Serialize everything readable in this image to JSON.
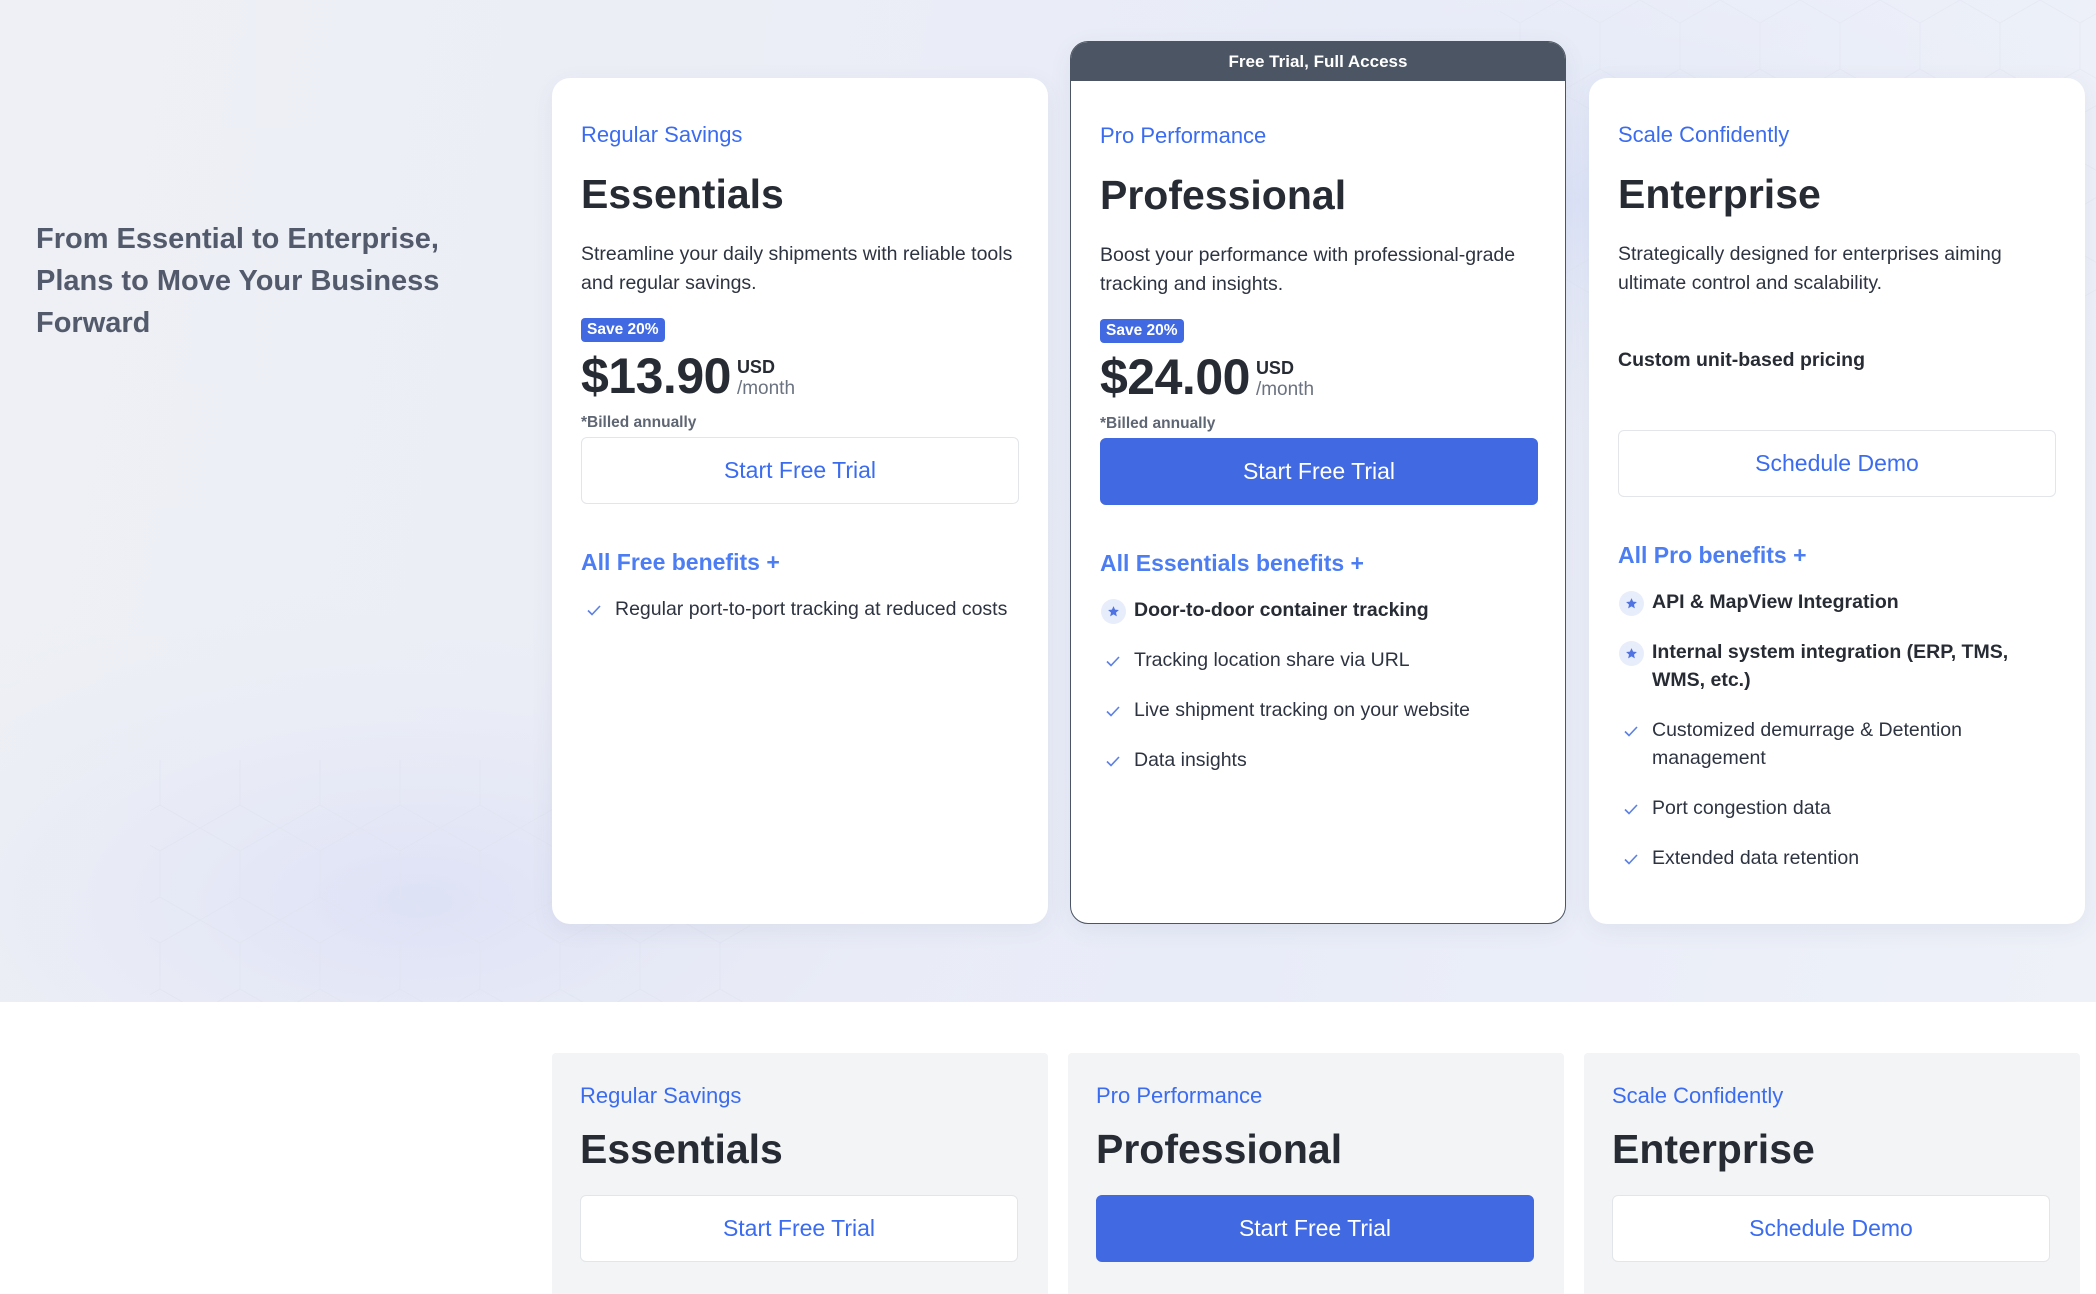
{
  "hero": {
    "heading_line1": "From Essential to Enterprise,",
    "heading_line2": "Plans to Move Your Business Forward"
  },
  "plans": [
    {
      "tagline": "Regular Savings",
      "name": "Essentials",
      "description": "Streamline your daily shipments with reliable tools and regular savings.",
      "badge": "Save 20%",
      "price": "$13.90",
      "currency": "USD",
      "period": "/month",
      "billed": "*Billed annually",
      "button": "Start Free Trial",
      "benefits_heading": "All Free benefits +",
      "features": [
        {
          "icon": "check-icon",
          "text": "Regular port-to-port tracking at reduced costs"
        }
      ]
    },
    {
      "banner": "Free Trial, Full Access",
      "tagline": "Pro Performance",
      "name": "Professional",
      "description": "Boost your performance with professional-grade tracking and insights.",
      "badge": "Save 20%",
      "price": "$24.00",
      "currency": "USD",
      "period": "/month",
      "billed": "*Billed annually",
      "button": "Start Free Trial",
      "benefits_heading": "All Essentials benefits +",
      "features": [
        {
          "icon": "star-icon",
          "text": "Door-to-door container tracking"
        },
        {
          "icon": "check-icon",
          "text": "Tracking location share via URL"
        },
        {
          "icon": "check-icon",
          "text": "Live shipment tracking on your website"
        },
        {
          "icon": "check-icon",
          "text": "Data insights"
        }
      ]
    },
    {
      "tagline": "Scale Confidently",
      "name": "Enterprise",
      "description": "Strategically designed for enterprises aiming ultimate control and scalability.",
      "custom_price": "Custom unit-based pricing",
      "button": "Schedule Demo",
      "benefits_heading": "All Pro benefits +",
      "features": [
        {
          "icon": "star-icon",
          "text": "API & MapView Integration"
        },
        {
          "icon": "star-icon",
          "text": "Internal system integration (ERP, TMS, WMS, etc.)"
        },
        {
          "icon": "check-icon",
          "text": "Customized demurrage & Detention management"
        },
        {
          "icon": "check-icon",
          "text": "Port congestion data"
        },
        {
          "icon": "check-icon",
          "text": "Extended data retention"
        }
      ]
    }
  ],
  "compare": [
    {
      "tagline": "Regular Savings",
      "name": "Essentials",
      "button": "Start Free Trial"
    },
    {
      "tagline": "Pro Performance",
      "name": "Professional",
      "button": "Start Free Trial"
    },
    {
      "tagline": "Scale Confidently",
      "name": "Enterprise",
      "button": "Schedule Demo"
    }
  ],
  "colors": {
    "accent": "#4169e1",
    "accent_text": "#3b6cf0",
    "banner": "#4b5563",
    "heading_gray": "#525a6b"
  }
}
